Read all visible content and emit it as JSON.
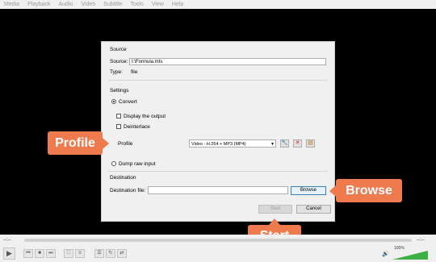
{
  "menubar": [
    "Media",
    "Playback",
    "Audio",
    "Video",
    "Subtitle",
    "Tools",
    "View",
    "Help"
  ],
  "dialog": {
    "source_group": "Source",
    "source_label": "Source:",
    "source_value": "I:\\Formula.mts",
    "type_label": "Type:",
    "type_value": "file",
    "settings_group": "Settings",
    "convert_label": "Convert",
    "display_output_label": "Display the output",
    "deinterlace_label": "Deinterlace",
    "profile_label": "Profile",
    "profile_value": "Video - H.264 + MP3 (MP4)",
    "dump_raw_label": "Dump raw input",
    "destination_group": "Destination",
    "destination_file_label": "Destination file:",
    "browse_label": "Browse",
    "start_label": "Start",
    "cancel_label": "Cancel"
  },
  "callouts": {
    "profile": "Profile",
    "browse": "Browse",
    "start": "Start"
  },
  "player": {
    "time_left": "--:--",
    "time_right": "--:--",
    "volume": "100%"
  },
  "colors": {
    "callout": "#ee7a4e",
    "video_bg": "#000000",
    "volume_fill": "#3cb043"
  }
}
